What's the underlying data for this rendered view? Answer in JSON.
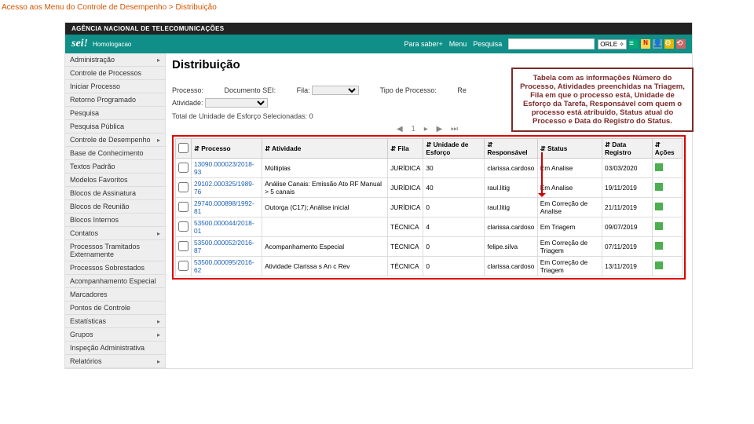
{
  "breadcrumb": "Acesso aos Menu do Controle de Desempenho > Distribuição",
  "org": "AGÊNCIA NACIONAL DE TELECOMUNICAÇÕES",
  "logo": "sei!",
  "logo_sub": "Homologacao",
  "top": {
    "saber": "Para saber+",
    "menu": "Menu",
    "pesq": "Pesquisa",
    "unit": "ORLE ✧"
  },
  "sidebar": {
    "items": [
      {
        "label": "Administração",
        "sub": true
      },
      {
        "label": "Controle de Processos"
      },
      {
        "label": "Iniciar Processo"
      },
      {
        "label": "Retorno Programado"
      },
      {
        "label": "Pesquisa"
      },
      {
        "label": "Pesquisa Pública"
      },
      {
        "label": "Controle de Desempenho",
        "sub": true
      },
      {
        "label": "Base de Conhecimento"
      },
      {
        "label": "Textos Padrão"
      },
      {
        "label": "Modelos Favoritos"
      },
      {
        "label": "Blocos de Assinatura"
      },
      {
        "label": "Blocos de Reunião"
      },
      {
        "label": "Blocos Internos"
      },
      {
        "label": "Contatos",
        "sub": true
      },
      {
        "label": "Processos Tramitados Externamente"
      },
      {
        "label": "Processos Sobrestados"
      },
      {
        "label": "Acompanhamento Especial"
      },
      {
        "label": "Marcadores"
      },
      {
        "label": "Pontos de Controle"
      },
      {
        "label": "Estatísticas",
        "sub": true
      },
      {
        "label": "Grupos",
        "sub": true
      },
      {
        "label": "Inspeção Administrativa"
      },
      {
        "label": "Relatórios",
        "sub": true
      }
    ]
  },
  "page": {
    "title": "Distribuição",
    "f": {
      "proc": "Processo:",
      "doc": "Documento SEI:",
      "fila": "Fila:",
      "tipo": "Tipo de Processo:",
      "re": "Re",
      "ativ": "Atividade:"
    },
    "total": "Total de Unidade de Esforço Selecionadas: 0"
  },
  "callout": "Tabela com as informações Número do Processo, Atividades preenchidas na Triagem, Fila em que o processo está, Unidade de Esforço da Tarefa, Responsável com quem o processo está atribuído, Status atual do Processo e Data do Registro do Status.",
  "table": {
    "headers": [
      "",
      "Processo",
      "Atividade",
      "Fila",
      "Unidade de Esforço",
      "Responsável",
      "Status",
      "Data Registro",
      "Ações"
    ],
    "rows": [
      {
        "proc": "13090.000023/2018-93",
        "ativ": "Múltiplas",
        "fila": "JURÍDICA",
        "ue": "30",
        "resp": "clarissa.cardoso",
        "status": "Em Analise",
        "data": "03/03/2020"
      },
      {
        "proc": "29102.000325/1989-76",
        "ativ": "Análise Canais: Emissão Ato RF Manual > 5 canais",
        "fila": "JURÍDICA",
        "ue": "40",
        "resp": "raul.litig",
        "status": "Em Analise",
        "data": "19/11/2019"
      },
      {
        "proc": "29740.000898/1992-81",
        "ativ": "Outorga (C17); Análise inicial",
        "fila": "JURÍDICA",
        "ue": "0",
        "resp": "raul.litig",
        "status": "Em Correção de Analise",
        "data": "21/11/2019"
      },
      {
        "proc": "53500.000044/2018-01",
        "ativ": "",
        "fila": "TÉCNICA",
        "ue": "4",
        "resp": "clarissa.cardoso",
        "status": "Em Triagem",
        "data": "09/07/2019"
      },
      {
        "proc": "53500.000052/2016-87",
        "ativ": "Acompanhamento Especial",
        "fila": "TÉCNICA",
        "ue": "0",
        "resp": "felipe.silva",
        "status": "Em Correção de Triagem",
        "data": "07/11/2019"
      },
      {
        "proc": "53500.000095/2016-62",
        "ativ": "Atividade Clarissa s An c Rev",
        "fila": "TÉCNICA",
        "ue": "0",
        "resp": "clarissa.cardoso",
        "status": "Em Correção de Triagem",
        "data": "13/11/2019"
      }
    ]
  }
}
